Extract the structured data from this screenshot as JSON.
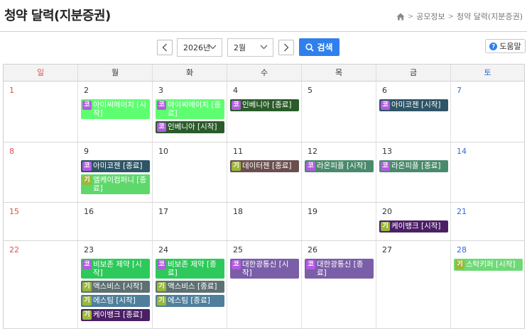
{
  "header": {
    "title": "청약 달력(지분증권)",
    "breadcrumb": [
      "공모정보",
      "청약 달력(지분증권)"
    ]
  },
  "controls": {
    "year": "2026년",
    "month": "2월",
    "search_label": "검색",
    "help_label": "도움말"
  },
  "colors": {
    "search_button": "#2f80ed",
    "tag_kospi": "#b45ce0",
    "tag_kosdaq": "#9bb83a"
  },
  "tags": {
    "kospi": "코",
    "kosdaq": "기"
  },
  "weekdays": [
    "일",
    "월",
    "화",
    "수",
    "목",
    "금",
    "토"
  ],
  "weeks": [
    [
      {
        "day": "1",
        "events": []
      },
      {
        "day": "2",
        "events": [
          {
            "tag": "코",
            "name": "아이씨에이치 [시작]",
            "color": "#5dff70"
          }
        ]
      },
      {
        "day": "3",
        "events": [
          {
            "tag": "코",
            "name": "아이씨에이치 [종료]",
            "color": "#5dff70"
          },
          {
            "tag": "코",
            "name": "인베니아 [시작]",
            "color": "#2a5b2a"
          }
        ]
      },
      {
        "day": "4",
        "events": [
          {
            "tag": "코",
            "name": "인베니아 [종료]",
            "color": "#2a5b2a"
          }
        ]
      },
      {
        "day": "5",
        "events": []
      },
      {
        "day": "6",
        "events": [
          {
            "tag": "코",
            "name": "아미코젠 [시작]",
            "color": "#2e5566"
          }
        ]
      },
      {
        "day": "7",
        "events": []
      }
    ],
    [
      {
        "day": "8",
        "events": []
      },
      {
        "day": "9",
        "events": [
          {
            "tag": "코",
            "name": "아미코젠 [종료]",
            "color": "#2e5566"
          },
          {
            "tag": "기",
            "name": "엘케이컴퍼니 [종료]",
            "color": "#5fd86b"
          }
        ]
      },
      {
        "day": "10",
        "events": []
      },
      {
        "day": "11",
        "events": [
          {
            "tag": "기",
            "name": "데이터젠 [종료]",
            "color": "#6b4f4f"
          }
        ]
      },
      {
        "day": "12",
        "events": [
          {
            "tag": "코",
            "name": "라온피플 [시작]",
            "color": "#4a8a6c"
          }
        ]
      },
      {
        "day": "13",
        "events": [
          {
            "tag": "코",
            "name": "라온피플 [종료]",
            "color": "#4a8a6c"
          }
        ]
      },
      {
        "day": "14",
        "events": []
      }
    ],
    [
      {
        "day": "15",
        "events": []
      },
      {
        "day": "16",
        "events": []
      },
      {
        "day": "17",
        "events": []
      },
      {
        "day": "18",
        "events": []
      },
      {
        "day": "19",
        "events": []
      },
      {
        "day": "20",
        "events": [
          {
            "tag": "기",
            "name": "케이뱅크 [시작]",
            "color": "#4b1f66"
          }
        ]
      },
      {
        "day": "21",
        "events": []
      }
    ],
    [
      {
        "day": "22",
        "events": []
      },
      {
        "day": "23",
        "events": [
          {
            "tag": "코",
            "name": "비보존 제약 [시작]",
            "color": "#2dc95a"
          },
          {
            "tag": "기",
            "name": "액스비스 [시작]",
            "color": "#5f7073"
          },
          {
            "tag": "기",
            "name": "에스팀 [시작]",
            "color": "#4f7f9c"
          },
          {
            "tag": "기",
            "name": "케이뱅크 [종료]",
            "color": "#4b1f66"
          }
        ]
      },
      {
        "day": "24",
        "events": [
          {
            "tag": "코",
            "name": "비보존 제약 [종료]",
            "color": "#2dc95a"
          },
          {
            "tag": "기",
            "name": "액스비스 [종료]",
            "color": "#5f7073"
          },
          {
            "tag": "기",
            "name": "에스팀 [종료]",
            "color": "#4f7f9c"
          }
        ]
      },
      {
        "day": "25",
        "events": [
          {
            "tag": "코",
            "name": "대한광통신 [시작]",
            "color": "#7a5ea8"
          }
        ]
      },
      {
        "day": "26",
        "events": [
          {
            "tag": "코",
            "name": "대한광통신 [종료]",
            "color": "#7a5ea8"
          }
        ]
      },
      {
        "day": "27",
        "events": []
      },
      {
        "day": "28",
        "events": [
          {
            "tag": "기",
            "name": "스탁키퍼 [시작]",
            "color": "#6fd977"
          }
        ]
      }
    ]
  ]
}
